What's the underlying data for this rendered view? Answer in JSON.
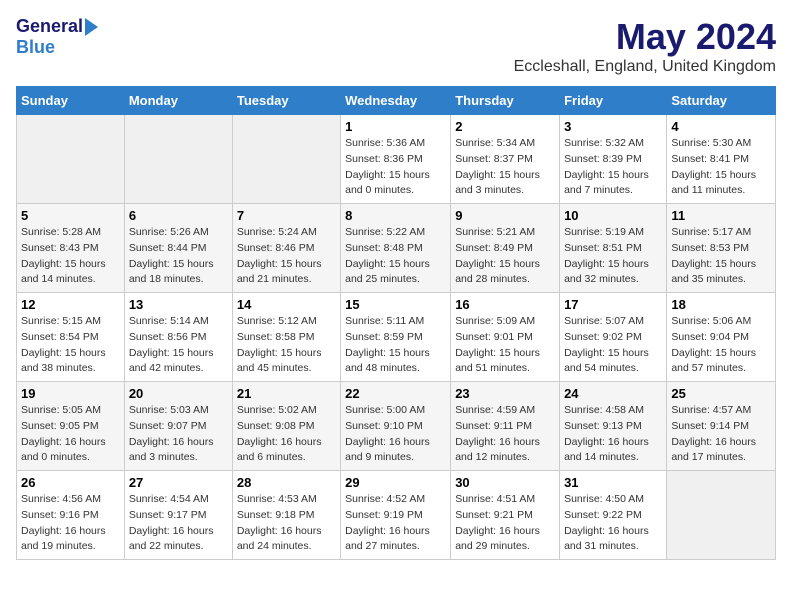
{
  "logo": {
    "general": "General",
    "blue": "Blue"
  },
  "title": "May 2024",
  "location": "Eccleshall, England, United Kingdom",
  "headers": [
    "Sunday",
    "Monday",
    "Tuesday",
    "Wednesday",
    "Thursday",
    "Friday",
    "Saturday"
  ],
  "weeks": [
    [
      {
        "day": "",
        "info": ""
      },
      {
        "day": "",
        "info": ""
      },
      {
        "day": "",
        "info": ""
      },
      {
        "day": "1",
        "info": "Sunrise: 5:36 AM\nSunset: 8:36 PM\nDaylight: 15 hours\nand 0 minutes."
      },
      {
        "day": "2",
        "info": "Sunrise: 5:34 AM\nSunset: 8:37 PM\nDaylight: 15 hours\nand 3 minutes."
      },
      {
        "day": "3",
        "info": "Sunrise: 5:32 AM\nSunset: 8:39 PM\nDaylight: 15 hours\nand 7 minutes."
      },
      {
        "day": "4",
        "info": "Sunrise: 5:30 AM\nSunset: 8:41 PM\nDaylight: 15 hours\nand 11 minutes."
      }
    ],
    [
      {
        "day": "5",
        "info": "Sunrise: 5:28 AM\nSunset: 8:43 PM\nDaylight: 15 hours\nand 14 minutes."
      },
      {
        "day": "6",
        "info": "Sunrise: 5:26 AM\nSunset: 8:44 PM\nDaylight: 15 hours\nand 18 minutes."
      },
      {
        "day": "7",
        "info": "Sunrise: 5:24 AM\nSunset: 8:46 PM\nDaylight: 15 hours\nand 21 minutes."
      },
      {
        "day": "8",
        "info": "Sunrise: 5:22 AM\nSunset: 8:48 PM\nDaylight: 15 hours\nand 25 minutes."
      },
      {
        "day": "9",
        "info": "Sunrise: 5:21 AM\nSunset: 8:49 PM\nDaylight: 15 hours\nand 28 minutes."
      },
      {
        "day": "10",
        "info": "Sunrise: 5:19 AM\nSunset: 8:51 PM\nDaylight: 15 hours\nand 32 minutes."
      },
      {
        "day": "11",
        "info": "Sunrise: 5:17 AM\nSunset: 8:53 PM\nDaylight: 15 hours\nand 35 minutes."
      }
    ],
    [
      {
        "day": "12",
        "info": "Sunrise: 5:15 AM\nSunset: 8:54 PM\nDaylight: 15 hours\nand 38 minutes."
      },
      {
        "day": "13",
        "info": "Sunrise: 5:14 AM\nSunset: 8:56 PM\nDaylight: 15 hours\nand 42 minutes."
      },
      {
        "day": "14",
        "info": "Sunrise: 5:12 AM\nSunset: 8:58 PM\nDaylight: 15 hours\nand 45 minutes."
      },
      {
        "day": "15",
        "info": "Sunrise: 5:11 AM\nSunset: 8:59 PM\nDaylight: 15 hours\nand 48 minutes."
      },
      {
        "day": "16",
        "info": "Sunrise: 5:09 AM\nSunset: 9:01 PM\nDaylight: 15 hours\nand 51 minutes."
      },
      {
        "day": "17",
        "info": "Sunrise: 5:07 AM\nSunset: 9:02 PM\nDaylight: 15 hours\nand 54 minutes."
      },
      {
        "day": "18",
        "info": "Sunrise: 5:06 AM\nSunset: 9:04 PM\nDaylight: 15 hours\nand 57 minutes."
      }
    ],
    [
      {
        "day": "19",
        "info": "Sunrise: 5:05 AM\nSunset: 9:05 PM\nDaylight: 16 hours\nand 0 minutes."
      },
      {
        "day": "20",
        "info": "Sunrise: 5:03 AM\nSunset: 9:07 PM\nDaylight: 16 hours\nand 3 minutes."
      },
      {
        "day": "21",
        "info": "Sunrise: 5:02 AM\nSunset: 9:08 PM\nDaylight: 16 hours\nand 6 minutes."
      },
      {
        "day": "22",
        "info": "Sunrise: 5:00 AM\nSunset: 9:10 PM\nDaylight: 16 hours\nand 9 minutes."
      },
      {
        "day": "23",
        "info": "Sunrise: 4:59 AM\nSunset: 9:11 PM\nDaylight: 16 hours\nand 12 minutes."
      },
      {
        "day": "24",
        "info": "Sunrise: 4:58 AM\nSunset: 9:13 PM\nDaylight: 16 hours\nand 14 minutes."
      },
      {
        "day": "25",
        "info": "Sunrise: 4:57 AM\nSunset: 9:14 PM\nDaylight: 16 hours\nand 17 minutes."
      }
    ],
    [
      {
        "day": "26",
        "info": "Sunrise: 4:56 AM\nSunset: 9:16 PM\nDaylight: 16 hours\nand 19 minutes."
      },
      {
        "day": "27",
        "info": "Sunrise: 4:54 AM\nSunset: 9:17 PM\nDaylight: 16 hours\nand 22 minutes."
      },
      {
        "day": "28",
        "info": "Sunrise: 4:53 AM\nSunset: 9:18 PM\nDaylight: 16 hours\nand 24 minutes."
      },
      {
        "day": "29",
        "info": "Sunrise: 4:52 AM\nSunset: 9:19 PM\nDaylight: 16 hours\nand 27 minutes."
      },
      {
        "day": "30",
        "info": "Sunrise: 4:51 AM\nSunset: 9:21 PM\nDaylight: 16 hours\nand 29 minutes."
      },
      {
        "day": "31",
        "info": "Sunrise: 4:50 AM\nSunset: 9:22 PM\nDaylight: 16 hours\nand 31 minutes."
      },
      {
        "day": "",
        "info": ""
      }
    ]
  ]
}
